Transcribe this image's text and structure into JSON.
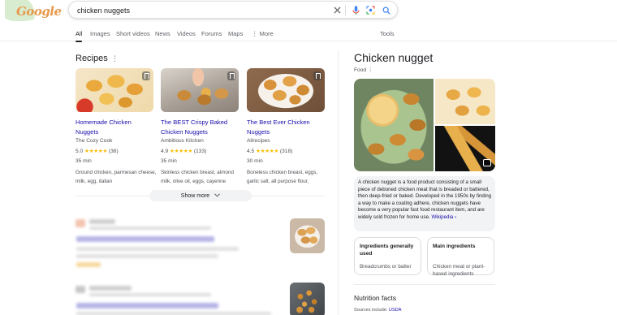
{
  "header": {
    "logo_text": "Google",
    "search_value": "chicken nuggets"
  },
  "tabs": [
    {
      "label": "All"
    },
    {
      "label": "Images"
    },
    {
      "label": "Short videos"
    },
    {
      "label": "News"
    },
    {
      "label": "Videos"
    },
    {
      "label": "Forums"
    },
    {
      "label": "Maps"
    },
    {
      "label": "More"
    }
  ],
  "tools_label": "Tools",
  "recipes": {
    "title": "Recipes",
    "items": [
      {
        "title": "Homemade Chicken Nuggets",
        "source": "The Cozy Cook",
        "rating": "5.0",
        "stars": "★★★★★",
        "reviews": "(38)",
        "time": "35 min",
        "ingredients": "Ground chicken, parmesan cheese, milk, egg, italian"
      },
      {
        "title": "The BEST Crispy Baked Chicken Nuggets",
        "source": "Ambitious Kitchen",
        "rating": "4.9",
        "stars": "★★★★★",
        "reviews": "(133)",
        "time": "35 min",
        "ingredients": "Skinless chicken breast, almond milk, olive oil, eggs, cayenne"
      },
      {
        "title": "The Best Ever Chicken Nuggets",
        "source": "Allrecipes",
        "rating": "4.5",
        "stars": "★★★★★",
        "reviews": "(318)",
        "time": "30 min",
        "ingredients": "Boneless chicken breast, eggs, garlic salt, all purpose flour,"
      }
    ],
    "show_more": "Show more"
  },
  "knowledge_panel": {
    "title": "Chicken nugget",
    "subtitle": "Food",
    "description": "A chicken nugget is a food product consisting of a small piece of deboned chicken meat that is breaded or battered, then deep-fried or baked. Developed in the 1950s by finding a way to make a coating adhere, chicken nuggets have become a very popular fast food restaurant item, and are widely sold frozen for home use.",
    "wiki_link": "Wikipedia",
    "facts": [
      {
        "heading": "Ingredients generally used",
        "value": "Breadcrumbs or batter"
      },
      {
        "heading": "Main ingredients",
        "value": "Chicken meat or plant-based ingredients"
      }
    ],
    "nutrition_title": "Nutrition facts",
    "sources_label": "Sources include:",
    "sources_link": "USDA"
  },
  "colors": {
    "link": "#1a0dab",
    "star": "#fbbc04",
    "text_secondary": "#4d5156"
  }
}
